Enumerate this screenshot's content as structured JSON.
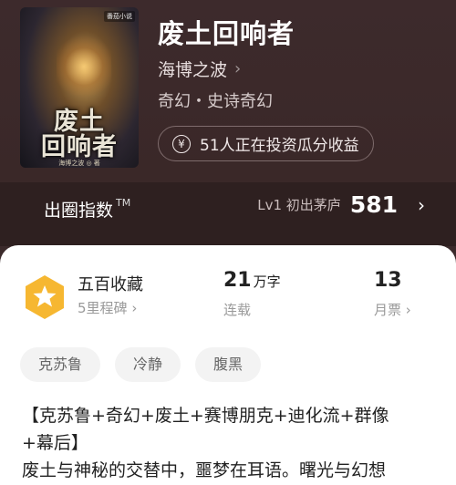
{
  "book": {
    "cover_title": "废土\n回响者",
    "cover_title_line1": "废土",
    "cover_title_line2": "回响者",
    "cover_author": "海博之波 ◎ 著",
    "cover_tag": "番茄小说",
    "title": "废土回响者",
    "author": "海博之波",
    "genre": "奇幻・史诗奇幻",
    "invest_text": "51人正在投资瓜分收益"
  },
  "influence": {
    "label": "出圈指数",
    "tm": "TM",
    "level": "Lv1 初出茅庐",
    "score": "581"
  },
  "stats": {
    "collect_title": "五百收藏",
    "collect_sub": "5里程碑",
    "words_value": "21",
    "words_unit": "万字",
    "words_sub": "连载",
    "tickets_value": "13",
    "tickets_sub": "月票"
  },
  "tags": [
    "克苏鲁",
    "冷静",
    "腹黑"
  ],
  "description": {
    "line1": "【克苏鲁+奇幻+废土+赛博朋克+迪化流+群像",
    "line2": "+幕后】",
    "line3": "废土与神秘的交替中，噩梦在耳语。曙光与幻想"
  },
  "colors": {
    "top_bg": "#3b2a2b",
    "badge": "#f6b731"
  }
}
